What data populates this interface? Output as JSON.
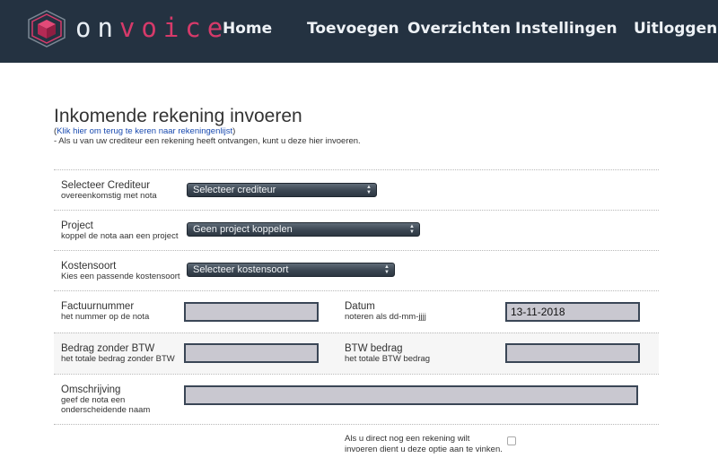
{
  "header": {
    "brand_on": "on",
    "brand_voice": "voice",
    "nav": [
      {
        "label": "Home"
      },
      {
        "label": "Toevoegen"
      },
      {
        "label": "Overzichten"
      },
      {
        "label": "Instellingen"
      },
      {
        "label": "Uitloggen"
      }
    ],
    "logo_icon": "hexagon-cube-logo",
    "colors": {
      "bar": "#243241",
      "accent": "#d63a6a"
    }
  },
  "page": {
    "title": "Inkomende rekening invoeren",
    "back_paren_open": "(",
    "back_link": "Klik hier om terug te keren naar rekeningenlijst",
    "back_paren_close": ")",
    "intro": " - Als u van uw crediteur een rekening heeft ontvangen, kunt u deze hier invoeren."
  },
  "form": {
    "crediteur": {
      "label": "Selecteer Crediteur",
      "hint": "overeenkomstig met nota",
      "value": "Selecteer crediteur"
    },
    "project": {
      "label": "Project",
      "hint": "koppel de nota aan een project",
      "value": "Geen project koppelen"
    },
    "kostensoort": {
      "label": "Kostensoort",
      "hint": "Kies een passende kostensoort",
      "value": "Selecteer kostensoort"
    },
    "factuurnummer": {
      "label": "Factuurnummer",
      "hint": "het nummer op de nota",
      "value": ""
    },
    "datum": {
      "label": "Datum",
      "hint": "noteren als dd-mm-jjjj",
      "value": "13-11-2018"
    },
    "bedrag": {
      "label": "Bedrag zonder BTW",
      "hint": "het totale bedrag zonder BTW",
      "value": ""
    },
    "btw": {
      "label": "BTW bedrag",
      "hint": "het totale BTW bedrag",
      "value": ""
    },
    "omschrijving": {
      "label": "Omschrijving",
      "hint_line1": "geef de nota een",
      "hint_line2": "onderscheidende naam",
      "value": ""
    },
    "direct": {
      "line1": "Als u direct nog een rekening wilt",
      "line2": "invoeren dient u deze optie aan te vinken.",
      "checked": false
    }
  }
}
